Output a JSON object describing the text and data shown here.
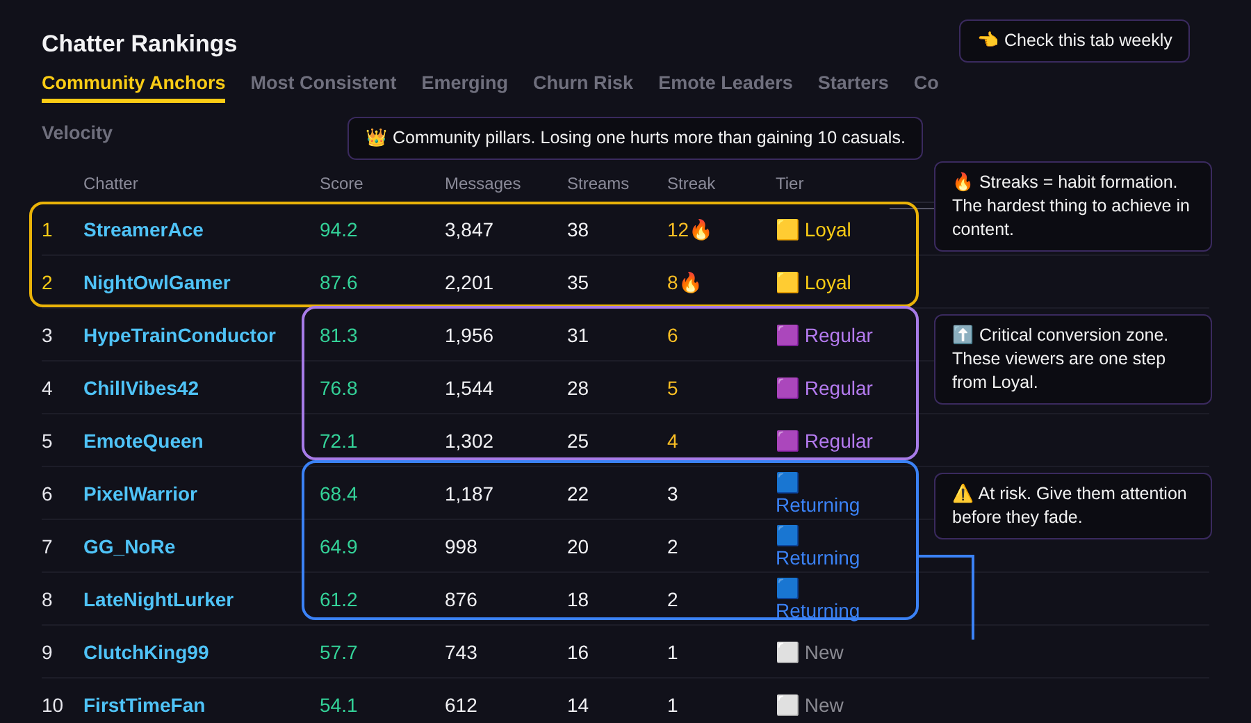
{
  "title": "Chatter Rankings",
  "tabs": [
    {
      "label": "Community Anchors",
      "selected": true
    },
    {
      "label": "Most Consistent",
      "selected": false
    },
    {
      "label": "Emerging",
      "selected": false
    },
    {
      "label": "Churn Risk",
      "selected": false
    },
    {
      "label": "Emote Leaders",
      "selected": false
    },
    {
      "label": "Starters",
      "selected": false
    },
    {
      "label": "Co",
      "selected": false
    },
    {
      "label": "Velocity",
      "selected": false
    }
  ],
  "table": {
    "columns": [
      "Chatter",
      "Score",
      "Messages",
      "Streams",
      "Streak",
      "Tier"
    ],
    "rows": [
      {
        "rank": "1",
        "name": "StreamerAce",
        "score": "94.2",
        "messages": "3,847",
        "streams": "38",
        "streak": "12🔥",
        "tier": {
          "kind": "loyal",
          "label": "🟨 Loyal"
        }
      },
      {
        "rank": "2",
        "name": "NightOwlGamer",
        "score": "87.6",
        "messages": "2,201",
        "streams": "35",
        "streak": "8🔥",
        "tier": {
          "kind": "loyal",
          "label": "🟨 Loyal"
        }
      },
      {
        "rank": "3",
        "name": "HypeTrainConductor",
        "score": "81.3",
        "messages": "1,956",
        "streams": "31",
        "streak": "6",
        "tier": {
          "kind": "regular",
          "label": "🟪 Regular"
        }
      },
      {
        "rank": "4",
        "name": "ChillVibes42",
        "score": "76.8",
        "messages": "1,544",
        "streams": "28",
        "streak": "5",
        "tier": {
          "kind": "regular",
          "label": "🟪 Regular"
        }
      },
      {
        "rank": "5",
        "name": "EmoteQueen",
        "score": "72.1",
        "messages": "1,302",
        "streams": "25",
        "streak": "4",
        "tier": {
          "kind": "regular",
          "label": "🟪 Regular"
        }
      },
      {
        "rank": "6",
        "name": "PixelWarrior",
        "score": "68.4",
        "messages": "1,187",
        "streams": "22",
        "streak": "3",
        "tier": {
          "kind": "returning",
          "label": "🟦 Returning"
        }
      },
      {
        "rank": "7",
        "name": "GG_NoRe",
        "score": "64.9",
        "messages": "998",
        "streams": "20",
        "streak": "2",
        "tier": {
          "kind": "returning",
          "label": "🟦 Returning"
        }
      },
      {
        "rank": "8",
        "name": "LateNightLurker",
        "score": "61.2",
        "messages": "876",
        "streams": "18",
        "streak": "2",
        "tier": {
          "kind": "returning",
          "label": "🟦 Returning"
        }
      },
      {
        "rank": "9",
        "name": "ClutchKing99",
        "score": "57.7",
        "messages": "743",
        "streams": "16",
        "streak": "1",
        "tier": {
          "kind": "new",
          "label": "⬜ New"
        }
      },
      {
        "rank": "10",
        "name": "FirstTimeFan",
        "score": "54.1",
        "messages": "612",
        "streams": "14",
        "streak": "1",
        "tier": {
          "kind": "new",
          "label": "⬜ New"
        }
      }
    ]
  },
  "callouts": [
    {
      "kind": "tab",
      "text": "👈 Check this tab weekly"
    },
    {
      "kind": "anchors",
      "text": "👑 Community pillars. Losing one hurts more than gaining 10 casuals."
    },
    {
      "kind": "streak",
      "text": "🔥 Streaks = habit formation. The hardest thing to achieve in content."
    },
    {
      "kind": "regular",
      "text": "⬆️ Critical conversion zone. These viewers are one step from Loyal."
    },
    {
      "kind": "returning",
      "text": "⚠️ At risk. Give them attention before they fade."
    }
  ]
}
